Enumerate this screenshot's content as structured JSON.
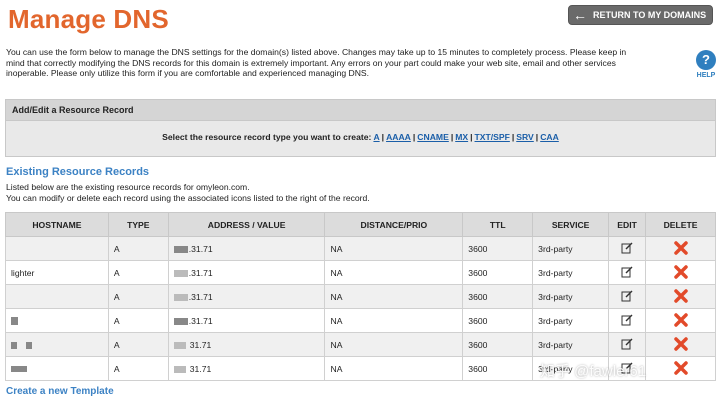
{
  "header": {
    "title": "Manage DNS",
    "return_label": "RETURN TO MY DOMAINS"
  },
  "intro": {
    "line1": "You can use the form below to manage the DNS settings for the domain(s) listed above. Changes may take up to 15 minutes to completely process. Please keep in",
    "line2": "mind that correctly modifying the DNS records for this domain is extremely important. Any errors on your part could make your web site, email and other services",
    "line3": "inoperable. Please only utilize this form if you are comfortable and experienced managing DNS."
  },
  "help": {
    "glyph": "?",
    "label": "HELP"
  },
  "add_box": {
    "title": "Add/Edit a Resource Record",
    "prompt": "Select the resource record type you want to create:",
    "types": [
      "A",
      "AAAA",
      "CNAME",
      "MX",
      "TXT/SPF",
      "SRV",
      "CAA"
    ],
    "separator": "|"
  },
  "records_section": {
    "title": "Existing Resource Records",
    "desc1": "Listed below are the existing resource records for omyleon.com.",
    "desc2": "You can modify or delete each record using the associated icons listed to the right of the record."
  },
  "table": {
    "headers": [
      "HOSTNAME",
      "TYPE",
      "ADDRESS / VALUE",
      "DISTANCE/PRIO",
      "TTL",
      "SERVICE",
      "EDIT",
      "DELETE"
    ],
    "rows": [
      {
        "hostname": "",
        "type": "A",
        "address": ".31.71",
        "prio": "NA",
        "ttl": "3600",
        "service": "3rd-party"
      },
      {
        "hostname": "lighter",
        "type": "A",
        "address": ".31.71",
        "prio": "NA",
        "ttl": "3600",
        "service": "3rd-party"
      },
      {
        "hostname": "",
        "type": "A",
        "address": ".31.71",
        "prio": "NA",
        "ttl": "3600",
        "service": "3rd-party"
      },
      {
        "hostname": "",
        "type": "A",
        "address": ".31.71",
        "prio": "NA",
        "ttl": "3600",
        "service": "3rd-party"
      },
      {
        "hostname": "",
        "type": "A",
        "address": "31.71",
        "prio": "NA",
        "ttl": "3600",
        "service": "3rd-party"
      },
      {
        "hostname": "",
        "type": "A",
        "address": "31.71",
        "prio": "NA",
        "ttl": "3600",
        "service": "3rd-party"
      }
    ]
  },
  "footer": {
    "create_template": "Create a new Template"
  },
  "watermark": "知乎 @fawler61",
  "colors": {
    "title": "#e2662d",
    "link": "#3c82c4",
    "delete": "#e24a2a"
  },
  "icons": {
    "return": "arrow-left-icon",
    "help": "help-icon",
    "edit": "edit-icon",
    "delete": "delete-icon"
  }
}
